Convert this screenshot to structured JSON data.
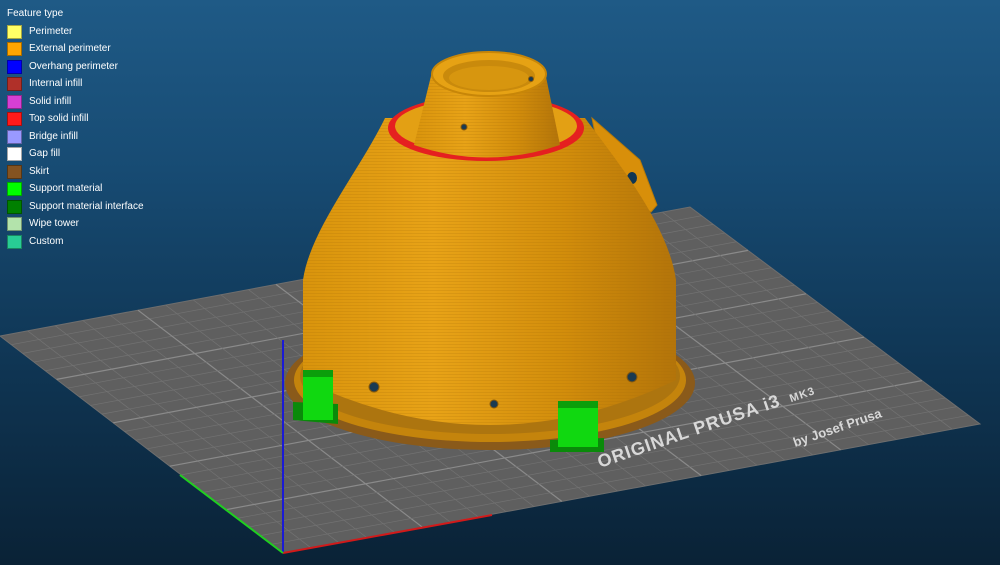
{
  "legend": {
    "title": "Feature type",
    "items": [
      {
        "label": "Perimeter",
        "color": "#ffff66"
      },
      {
        "label": "External perimeter",
        "color": "#ffa500"
      },
      {
        "label": "Overhang perimeter",
        "color": "#0000ff"
      },
      {
        "label": "Internal infill",
        "color": "#b03029"
      },
      {
        "label": "Solid infill",
        "color": "#d63fd4"
      },
      {
        "label": "Top solid infill",
        "color": "#ff1a1a"
      },
      {
        "label": "Bridge infill",
        "color": "#9999ff"
      },
      {
        "label": "Gap fill",
        "color": "#ffffff"
      },
      {
        "label": "Skirt",
        "color": "#845321"
      },
      {
        "label": "Support material",
        "color": "#00ff00"
      },
      {
        "label": "Support material interface",
        "color": "#008000"
      },
      {
        "label": "Wipe tower",
        "color": "#b3e3ab"
      },
      {
        "label": "Custom",
        "color": "#28cc94"
      }
    ]
  },
  "bed": {
    "brand_line1": "ORIGINAL PRUSA i3",
    "brand_model": "MK3",
    "brand_line2": "by Josef Prusa"
  },
  "colors": {
    "bed": "#5f5f5f",
    "model": "#e59e0f",
    "axis_x": "#d01a1a",
    "axis_y": "#1fcf1f",
    "axis_z": "#1a1ad6"
  }
}
